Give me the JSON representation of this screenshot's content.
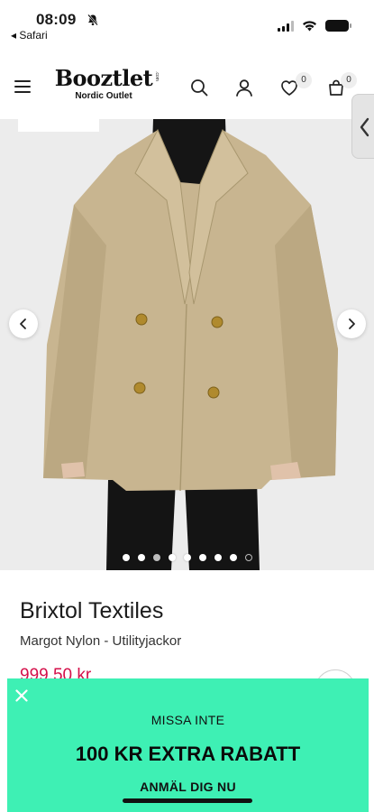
{
  "status_bar": {
    "time": "08:09",
    "back_app": "◂ Safari"
  },
  "header": {
    "logo_name": "Booztlet",
    "logo_suffix": ".com",
    "logo_subtitle": "Nordic Outlet",
    "wishlist_count": "0",
    "cart_count": "0"
  },
  "carousel": {
    "slide_count": 9,
    "active_slide": 3
  },
  "product": {
    "brand": "Brixtol Textiles",
    "name": "Margot Nylon - Utilityjackor",
    "price": "999,50 kr"
  },
  "promo": {
    "kicker": "MISSA INTE",
    "title": "100 KR EXTRA RABATT",
    "cta": "ANMÄL DIG NU"
  },
  "colors": {
    "promo_background": "#3ef0b4",
    "price": "#d4104a",
    "coat": "#c8b590"
  }
}
